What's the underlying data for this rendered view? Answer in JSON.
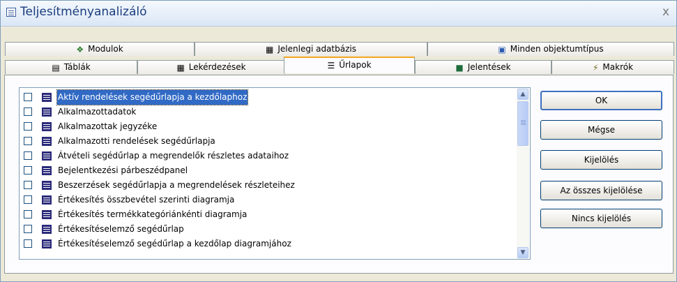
{
  "window": {
    "title": "Teljesítményanalizáló",
    "close_glyph": "x"
  },
  "tabs_row1": [
    {
      "label": "Modulok",
      "icon": "modules-icon"
    },
    {
      "label": "Jelenlegi adatbázis",
      "icon": "current-database-icon"
    },
    {
      "label": "Minden objektumtípus",
      "icon": "all-object-types-icon"
    }
  ],
  "tabs_row2": [
    {
      "label": "Táblák",
      "icon": "table-icon"
    },
    {
      "label": "Lekérdezések",
      "icon": "query-icon"
    },
    {
      "label": "Űrlapok",
      "icon": "form-icon",
      "active": true
    },
    {
      "label": "Jelentések",
      "icon": "report-icon"
    },
    {
      "label": "Makrók",
      "icon": "macro-icon"
    }
  ],
  "list": {
    "selected_index": 0,
    "items": [
      "Aktív rendelések segédűrlapja a kezdőlaphoz",
      "Alkalmazottadatok",
      "Alkalmazottak jegyzéke",
      "Alkalmazotti rendelések segédűrlapja",
      "Átvételi segédűrlap a megrendelők részletes adataihoz",
      "Bejelentkezési párbeszédpanel",
      "Beszerzések segédűrlapja a megrendelések részleteihez",
      "Értékesítés összbevétel szerinti diagramja",
      "Értékesítés termékkategóriánkénti diagramja",
      "Értékesítéselemző segédűrlap",
      "Értékesítéselemző segédűrlap a kezdőlap diagramjához"
    ]
  },
  "buttons": {
    "ok": "OK",
    "cancel": "Mégse",
    "select": "Kijelölés",
    "select_all": "Az összes kijelölése",
    "select_none": "Nincs kijelölés"
  },
  "colors": {
    "selection": "#316ac5",
    "active_tab_accent": "#f5a623",
    "title_text": "#1a3c7c"
  }
}
